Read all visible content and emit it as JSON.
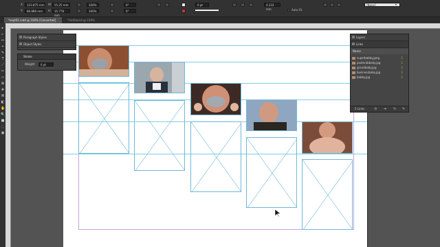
{
  "control_bar": {
    "x_label": "X:",
    "x_value": "123.875 mm",
    "y_label": "Y:",
    "y_value": "86.886 mm",
    "w_label": "W:",
    "w_value": "55.25 mm",
    "h_label": "H:",
    "h_value": "35.778 mm",
    "scale_x": "100%",
    "scale_y": "100%",
    "angle": "0°",
    "shear": "0°",
    "stroke_weight": "0 pt",
    "frame_fitting_value": "4.233 mm",
    "auto_fit_label": "Auto-Fit",
    "style_value": "[None]",
    "zoom_value": "100%"
  },
  "tabs": [
    {
      "label": "*expt01.indd @ 100% [Converted]",
      "active": true
    },
    {
      "label": "*Untitled-8 @ 150%",
      "active": false
    }
  ],
  "tools": [
    "▸",
    "▹",
    "↔",
    "⌖",
    "✎",
    "T",
    "／",
    "✂",
    "▭",
    "⊠",
    "✥",
    "⌘",
    "◧",
    "✋",
    "🔍",
    "■",
    "⬚",
    "▣"
  ],
  "panels": {
    "paragraph_styles": "Paragraph Styles",
    "object_styles": "Object Styles",
    "stroke": {
      "title": "Stroke",
      "weight_label": "Weight:",
      "weight_value": "0 pt"
    },
    "layers_tab": "Layers",
    "links_tab": "Links",
    "links_header": "Name",
    "links": [
      {
        "name": "superbabby.jpeg",
        "page": "1"
      },
      {
        "name": "poolerabbaby.jpg",
        "page": "1"
      },
      {
        "name": "grandbaby.jpg",
        "page": "1"
      },
      {
        "name": "businessbaby.jpg",
        "page": "1"
      },
      {
        "name": "babby.jpg",
        "page": "1"
      }
    ],
    "links_footer": "5 Links"
  },
  "colors": {
    "app_bg": "#535353",
    "panel_bg": "#454545",
    "guide": "#7ad0e6",
    "margin": "#c9a0d6",
    "link_page": "#c8a24a"
  }
}
